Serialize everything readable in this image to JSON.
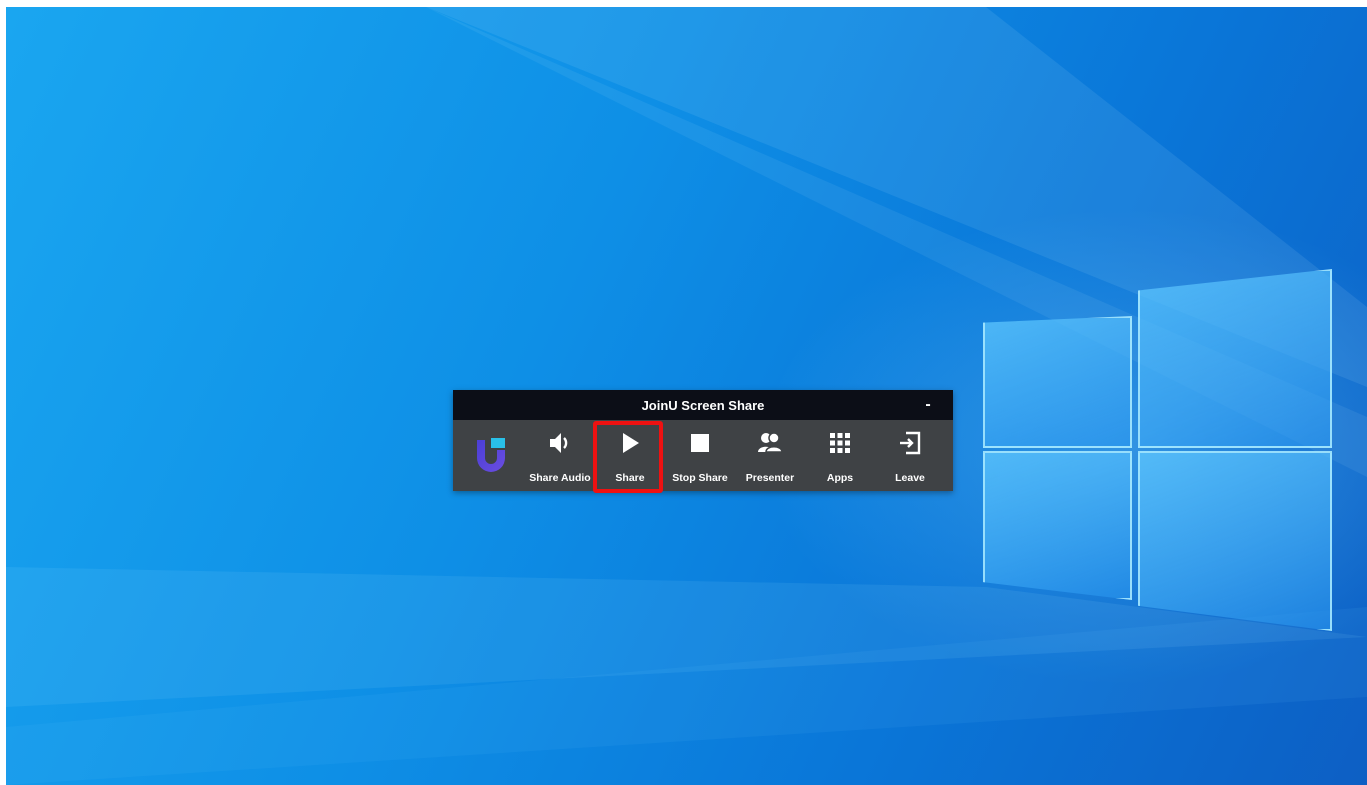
{
  "desktop": {
    "wallpaper": "windows-10-hero-wallpaper",
    "accent": "#0a76d8"
  },
  "toolbar": {
    "title": "JoinU Screen Share",
    "minimize_label": "-",
    "logo": "joinu-logo",
    "buttons": [
      {
        "label": "Share Audio",
        "icon": "speaker-icon"
      },
      {
        "label": "Share",
        "icon": "play-icon",
        "highlighted": true,
        "highlight_color": "#ee1111"
      },
      {
        "label": "Stop Share",
        "icon": "stop-icon"
      },
      {
        "label": "Presenter",
        "icon": "presenter-icon"
      },
      {
        "label": "Apps",
        "icon": "apps-grid-icon"
      },
      {
        "label": "Leave",
        "icon": "leave-icon"
      }
    ]
  }
}
